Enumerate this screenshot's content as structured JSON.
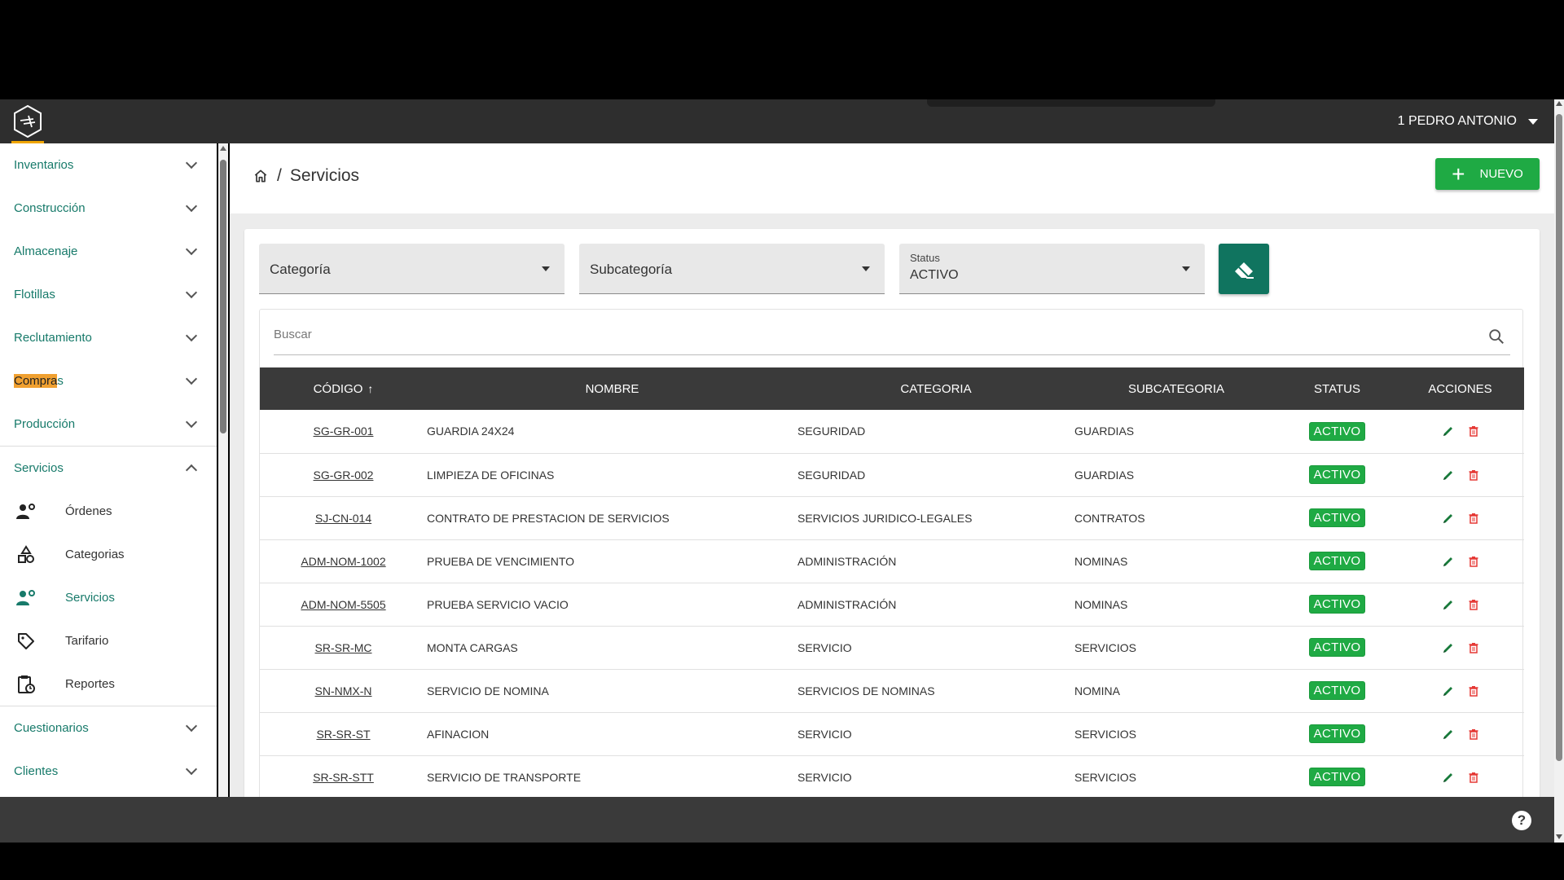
{
  "header": {
    "user_name": "1 PEDRO ANTONIO"
  },
  "sidebar": {
    "groups_top": [
      {
        "label": "Inventarios"
      },
      {
        "label": "Construcción"
      },
      {
        "label": "Almacenaje"
      },
      {
        "label": "Flotillas"
      },
      {
        "label": "Reclutamiento"
      },
      {
        "label_highlight": "Compra",
        "label_rest": "s"
      },
      {
        "label": "Producción"
      }
    ],
    "open_group": {
      "label": "Servicios",
      "items": [
        {
          "label": "Órdenes",
          "icon": "user-gear-icon"
        },
        {
          "label": "Categorias",
          "icon": "shapes-icon"
        },
        {
          "label": "Servicios",
          "icon": "user-gear-icon"
        },
        {
          "label": "Tarifario",
          "icon": "tag-icon"
        },
        {
          "label": "Reportes",
          "icon": "clipboard-clock-icon"
        }
      ]
    },
    "groups_bottom": [
      {
        "label": "Cuestionarios"
      },
      {
        "label": "Clientes"
      }
    ]
  },
  "page": {
    "breadcrumb_sep": "/",
    "title": "Servicios",
    "new_button": "NUEVO"
  },
  "filters": {
    "category_label": "Categoría",
    "subcategory_label": "Subcategoría",
    "status_label": "Status",
    "status_value": "ACTIVO"
  },
  "search": {
    "placeholder": "Buscar"
  },
  "table": {
    "columns": [
      "CÓDIGO",
      "NOMBRE",
      "CATEGORIA",
      "SUBCATEGORIA",
      "STATUS",
      "ACCIONES"
    ],
    "sort_indicator": "↑",
    "rows": [
      {
        "code": "SG-GR-001",
        "name": "GUARDIA 24X24",
        "category": "SEGURIDAD",
        "subcategory": "GUARDIAS",
        "status": "ACTIVO"
      },
      {
        "code": "SG-GR-002",
        "name": "LIMPIEZA DE OFICINAS",
        "category": "SEGURIDAD",
        "subcategory": "GUARDIAS",
        "status": "ACTIVO"
      },
      {
        "code": "SJ-CN-014",
        "name": "CONTRATO DE PRESTACION DE SERVICIOS",
        "category": "SERVICIOS JURIDICO-LEGALES",
        "subcategory": "CONTRATOS",
        "status": "ACTIVO"
      },
      {
        "code": "ADM-NOM-1002",
        "name": "PRUEBA DE VENCIMIENTO",
        "category": "ADMINISTRACIÓN",
        "subcategory": "NOMINAS",
        "status": "ACTIVO"
      },
      {
        "code": "ADM-NOM-5505",
        "name": "PRUEBA SERVICIO VACIO",
        "category": "ADMINISTRACIÓN",
        "subcategory": "NOMINAS",
        "status": "ACTIVO"
      },
      {
        "code": "SR-SR-MC",
        "name": "MONTA CARGAS",
        "category": "SERVICIO",
        "subcategory": "SERVICIOS",
        "status": "ACTIVO"
      },
      {
        "code": "SN-NMX-N",
        "name": "SERVICIO DE NOMINA",
        "category": "SERVICIOS DE NOMINAS",
        "subcategory": "NOMINA",
        "status": "ACTIVO"
      },
      {
        "code": "SR-SR-ST",
        "name": "AFINACION",
        "category": "SERVICIO",
        "subcategory": "SERVICIOS",
        "status": "ACTIVO"
      },
      {
        "code": "SR-SR-STT",
        "name": "SERVICIO DE TRANSPORTE",
        "category": "SERVICIO",
        "subcategory": "SERVICIOS",
        "status": "ACTIVO"
      }
    ]
  },
  "footer": {
    "help_label": "?"
  },
  "colors": {
    "accent_teal": "#177a6a",
    "button_green": "#1faa44",
    "clear_button": "#10745f",
    "header_dark": "#2e2e2e",
    "highlight": "#f0a030",
    "delete_red": "#e53935"
  }
}
